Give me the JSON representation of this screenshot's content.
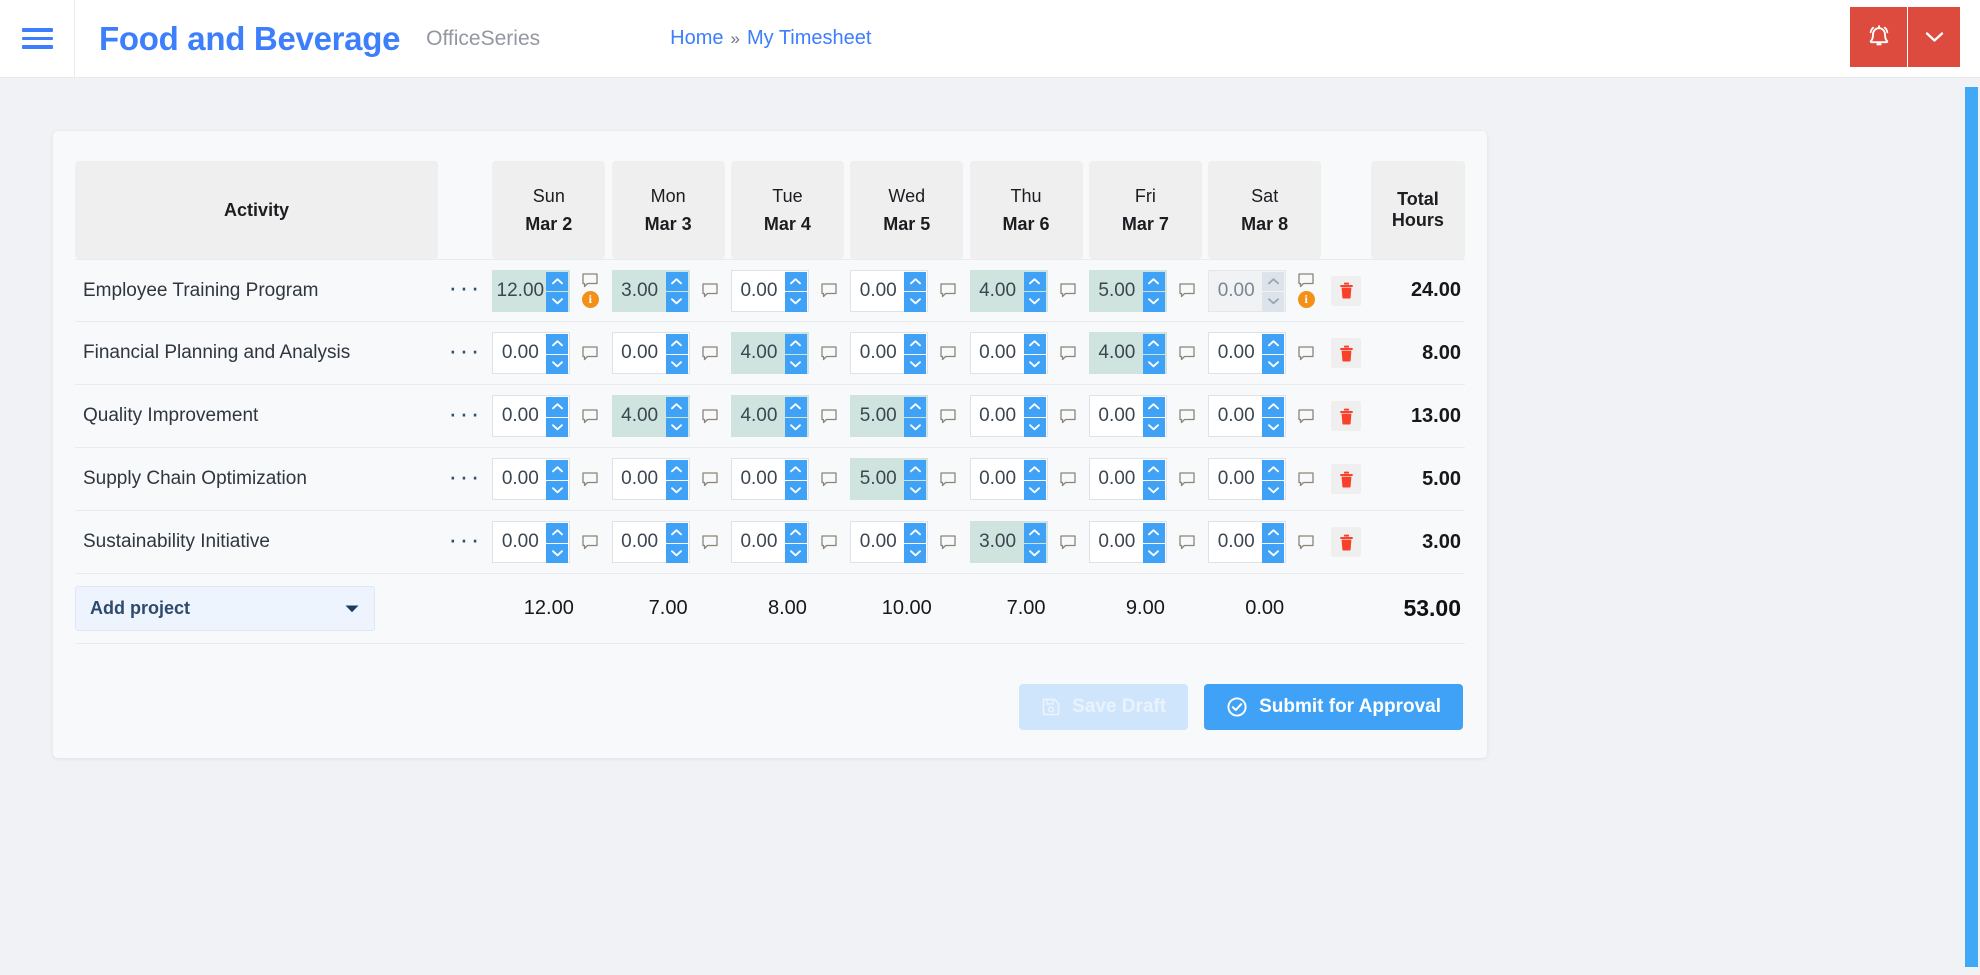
{
  "header": {
    "menu_icon": "hamburger-icon",
    "brand": "Food and Beverage",
    "suite": "OfficeSeries",
    "breadcrumb": {
      "home": "Home",
      "separator": "»",
      "current": "My Timesheet"
    },
    "notification_icon": "bell-icon",
    "notification_caret_icon": "chevron-down-icon",
    "accent_red": "#dd4b3e",
    "accent_blue": "#3d7efc"
  },
  "table": {
    "columns": {
      "activity": "Activity",
      "total": "Total Hours",
      "days": [
        {
          "dow": "Sun",
          "date": "Mar 2"
        },
        {
          "dow": "Mon",
          "date": "Mar 3"
        },
        {
          "dow": "Tue",
          "date": "Mar 4"
        },
        {
          "dow": "Wed",
          "date": "Mar 5"
        },
        {
          "dow": "Thu",
          "date": "Mar 6"
        },
        {
          "dow": "Fri",
          "date": "Mar 7"
        },
        {
          "dow": "Sat",
          "date": "Mar 8"
        }
      ]
    },
    "row_menu_label": "···",
    "delete_icon": "trash-icon",
    "comment_icon": "comment-icon",
    "info_icon": "info-badge-icon",
    "spinner_up_icon": "chevron-up-icon",
    "spinner_down_icon": "chevron-down-icon",
    "filled_cell_color": "#cfe4de",
    "rows": [
      {
        "activity": "Employee Training Program",
        "total": "24.00",
        "cells": [
          {
            "value": "12.00",
            "filled": true,
            "disabled": false,
            "info": true
          },
          {
            "value": "3.00",
            "filled": true,
            "disabled": false,
            "info": false
          },
          {
            "value": "0.00",
            "filled": false,
            "disabled": false,
            "info": false
          },
          {
            "value": "0.00",
            "filled": false,
            "disabled": false,
            "info": false
          },
          {
            "value": "4.00",
            "filled": true,
            "disabled": false,
            "info": false
          },
          {
            "value": "5.00",
            "filled": true,
            "disabled": false,
            "info": false
          },
          {
            "value": "0.00",
            "filled": false,
            "disabled": true,
            "info": true
          }
        ]
      },
      {
        "activity": "Financial Planning and Analysis",
        "total": "8.00",
        "cells": [
          {
            "value": "0.00",
            "filled": false,
            "disabled": false,
            "info": false
          },
          {
            "value": "0.00",
            "filled": false,
            "disabled": false,
            "info": false
          },
          {
            "value": "4.00",
            "filled": true,
            "disabled": false,
            "info": false
          },
          {
            "value": "0.00",
            "filled": false,
            "disabled": false,
            "info": false
          },
          {
            "value": "0.00",
            "filled": false,
            "disabled": false,
            "info": false
          },
          {
            "value": "4.00",
            "filled": true,
            "disabled": false,
            "info": false
          },
          {
            "value": "0.00",
            "filled": false,
            "disabled": false,
            "info": false
          }
        ]
      },
      {
        "activity": "Quality Improvement",
        "total": "13.00",
        "cells": [
          {
            "value": "0.00",
            "filled": false,
            "disabled": false,
            "info": false
          },
          {
            "value": "4.00",
            "filled": true,
            "disabled": false,
            "info": false
          },
          {
            "value": "4.00",
            "filled": true,
            "disabled": false,
            "info": false
          },
          {
            "value": "5.00",
            "filled": true,
            "disabled": false,
            "info": false
          },
          {
            "value": "0.00",
            "filled": false,
            "disabled": false,
            "info": false
          },
          {
            "value": "0.00",
            "filled": false,
            "disabled": false,
            "info": false
          },
          {
            "value": "0.00",
            "filled": false,
            "disabled": false,
            "info": false
          }
        ]
      },
      {
        "activity": "Supply Chain Optimization",
        "total": "5.00",
        "cells": [
          {
            "value": "0.00",
            "filled": false,
            "disabled": false,
            "info": false
          },
          {
            "value": "0.00",
            "filled": false,
            "disabled": false,
            "info": false
          },
          {
            "value": "0.00",
            "filled": false,
            "disabled": false,
            "info": false
          },
          {
            "value": "5.00",
            "filled": true,
            "disabled": false,
            "info": false
          },
          {
            "value": "0.00",
            "filled": false,
            "disabled": false,
            "info": false
          },
          {
            "value": "0.00",
            "filled": false,
            "disabled": false,
            "info": false
          },
          {
            "value": "0.00",
            "filled": false,
            "disabled": false,
            "info": false
          }
        ]
      },
      {
        "activity": "Sustainability Initiative",
        "total": "3.00",
        "cells": [
          {
            "value": "0.00",
            "filled": false,
            "disabled": false,
            "info": false
          },
          {
            "value": "0.00",
            "filled": false,
            "disabled": false,
            "info": false
          },
          {
            "value": "0.00",
            "filled": false,
            "disabled": false,
            "info": false
          },
          {
            "value": "0.00",
            "filled": false,
            "disabled": false,
            "info": false
          },
          {
            "value": "3.00",
            "filled": true,
            "disabled": false,
            "info": false
          },
          {
            "value": "0.00",
            "filled": false,
            "disabled": false,
            "info": false
          },
          {
            "value": "0.00",
            "filled": false,
            "disabled": false,
            "info": false
          }
        ]
      }
    ],
    "footer": {
      "add_project_label": "Add project",
      "add_project_caret_icon": "caret-down-icon",
      "day_totals": [
        "12.00",
        "7.00",
        "8.00",
        "10.00",
        "7.00",
        "9.00",
        "0.00"
      ],
      "grand_total": "53.00"
    }
  },
  "actions": {
    "save_draft_label": "Save Draft",
    "save_draft_icon": "save-icon",
    "submit_label": "Submit for Approval",
    "submit_icon": "check-circle-icon"
  }
}
